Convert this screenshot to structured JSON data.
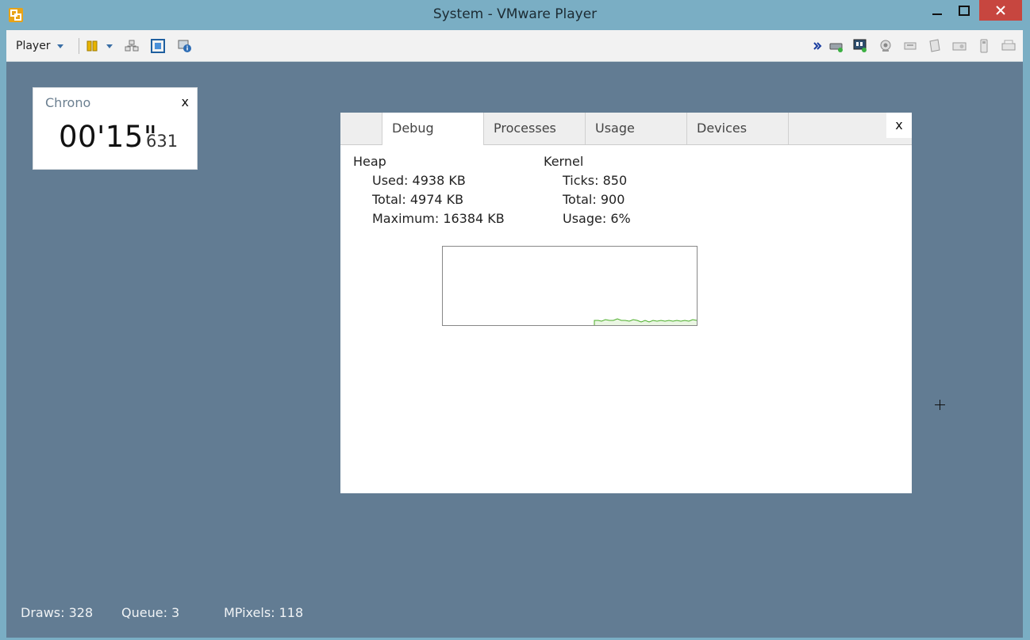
{
  "window": {
    "title": "System - VMware Player"
  },
  "toolbar": {
    "player_menu_label": "Player"
  },
  "chrono": {
    "title": "Chrono",
    "close_label": "x",
    "time": "00'15\"",
    "milliseconds": "631"
  },
  "debug_panel": {
    "tabs": [
      {
        "label": "Debug",
        "active": true
      },
      {
        "label": "Processes",
        "active": false
      },
      {
        "label": "Usage",
        "active": false
      },
      {
        "label": "Devices",
        "active": false
      }
    ],
    "close_label": "x",
    "heap": {
      "title": "Heap",
      "used": "Used: 4938 KB",
      "total": "Total: 4974 KB",
      "maximum": "Maximum: 16384 KB"
    },
    "kernel": {
      "title": "Kernel",
      "ticks": "Ticks: 850",
      "total": "Total: 900",
      "usage": "Usage: 6%"
    },
    "graph_color": "#4caf2a"
  },
  "status_bar": {
    "draws": "Draws: 328",
    "queue": "Queue: 3",
    "mpixels": "MPixels: 118"
  },
  "colors": {
    "titlebar": "#7aaec4",
    "guest_background": "#627c93",
    "close_button": "#c7463f"
  }
}
